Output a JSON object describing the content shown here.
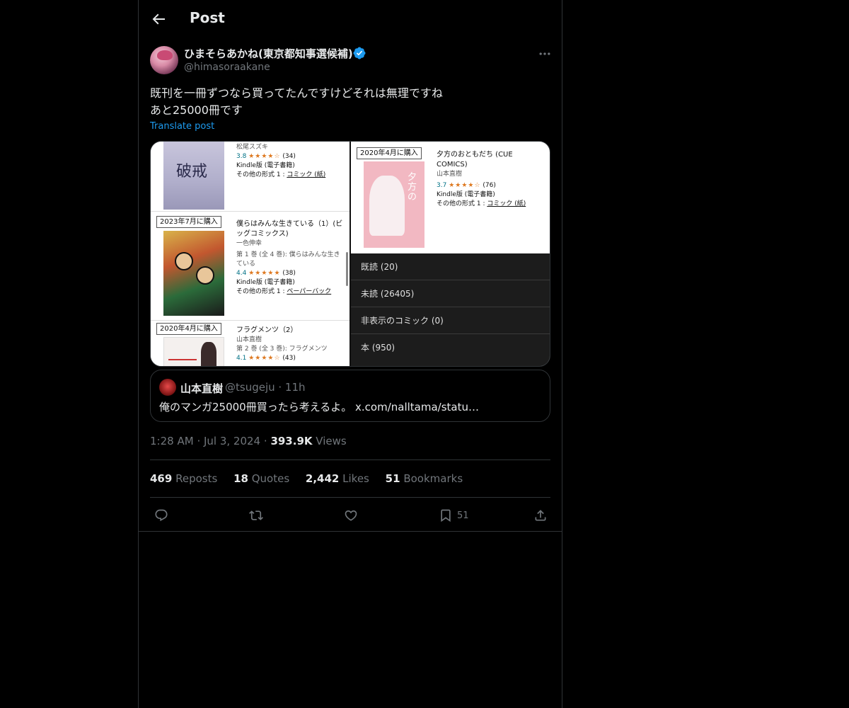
{
  "header": {
    "title": "Post"
  },
  "author": {
    "display_name": "ひまそらあかね(東京都知事選候補)",
    "handle": "@himasoraakane"
  },
  "post": {
    "text_line1": "既刊を一冊ずつなら買ってたんですけどそれは無理ですね",
    "text_line2": "あと25000冊です",
    "translate": "Translate post"
  },
  "media": {
    "left_books": [
      {
        "tag": "",
        "cover_text": "破戒",
        "author": "松尾スズキ",
        "rating": "3.8",
        "stars": "★★★★☆",
        "count": "(34)",
        "format": "Kindle版 (電子書籍)",
        "other_prefix": "その他の形式 1 : ",
        "other_link": "コミック (紙)"
      },
      {
        "tag": "2023年7月に購入",
        "title": "僕らはみんな生きている（1）(ビッグコミックス)",
        "author": "一色伸幸",
        "volume": "第 1 巻 (全 4 巻): 僕らはみんな生きている",
        "rating": "4.4",
        "stars": "★★★★★",
        "count": "(38)",
        "format": "Kindle版 (電子書籍)",
        "other_prefix": "その他の形式 1 : ",
        "other_link": "ペーパーバック"
      },
      {
        "tag": "2020年4月に購入",
        "title": "フラグメンツ（2）",
        "author": "山本直樹",
        "volume": "第 2 巻 (全 3 巻): フラグメンツ",
        "rating": "4.1",
        "stars": "★★★★☆",
        "count": "(43)"
      }
    ],
    "right_book": {
      "tag": "2020年4月に購入",
      "title": "夕方のおともだち (CUE COMICS)",
      "author": "山本直樹",
      "rating": "3.7",
      "stars": "★★★★☆",
      "count": "(76)",
      "format": "Kindle版 (電子書籍)",
      "other_prefix": "その他の形式 1 : ",
      "other_link": "コミック (紙)"
    },
    "menu": [
      {
        "label": "既読 (20)"
      },
      {
        "label": "未読 (26405)"
      },
      {
        "label": "非表示のコミック (0)"
      },
      {
        "label": "本 (950)"
      }
    ]
  },
  "quote": {
    "name": "山本直樹",
    "handle": "@tsugeju · 11h",
    "text": "俺のマンガ25000冊買ったら考えるよ。 x.com/nalltama/statu…"
  },
  "meta": {
    "time": "1:28 AM",
    "date": "Jul 3, 2024",
    "views_count": "393.9K",
    "views_label": "Views"
  },
  "stats": {
    "reposts_count": "469",
    "reposts_label": "Reposts",
    "quotes_count": "18",
    "quotes_label": "Quotes",
    "likes_count": "2,442",
    "likes_label": "Likes",
    "bookmarks_count": "51",
    "bookmarks_label": "Bookmarks"
  },
  "actions": {
    "bookmark_count": "51"
  },
  "colors": {
    "background": "#000000",
    "accent": "#1d9bf0",
    "text": "#e7e9ea",
    "muted": "#71767b",
    "border": "#2f3336"
  }
}
